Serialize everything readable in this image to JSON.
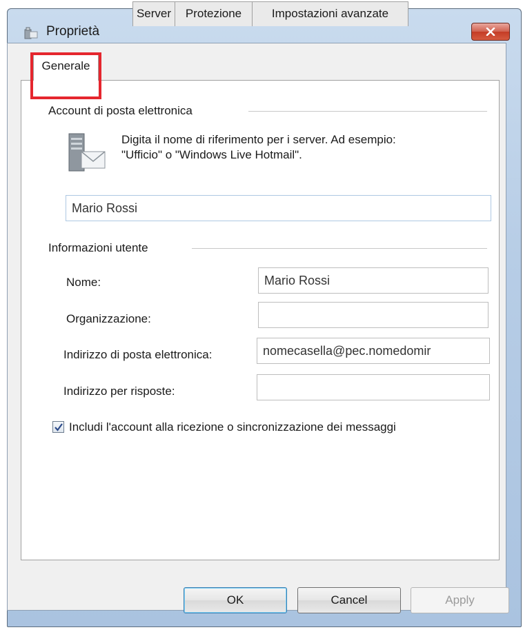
{
  "window": {
    "title": "Proprietà"
  },
  "tabs": [
    {
      "label": "Generale"
    },
    {
      "label": "Server"
    },
    {
      "label": "Protezione"
    },
    {
      "label": "Impostazioni avanzate"
    }
  ],
  "account": {
    "group_label": "Account di posta elettronica",
    "description_line1": "Digita il nome di riferimento per i server. Ad esempio:",
    "description_line2": "\"Ufficio\" o \"Windows Live Hotmail\".",
    "account_name": "Mario Rossi"
  },
  "user_info": {
    "group_label": "Informazioni utente",
    "name_label": "Nome:",
    "name_value": "Mario Rossi",
    "org_label": "Organizzazione:",
    "org_value": "",
    "email_label": "Indirizzo di posta elettronica:",
    "email_value": "nomecasella@pec.nomedomir",
    "reply_label": "Indirizzo per risposte:",
    "reply_value": ""
  },
  "include_checkbox": {
    "label": "Includi l'account alla ricezione o sincronizzazione dei messaggi",
    "checked": true
  },
  "buttons": {
    "ok": "OK",
    "cancel": "Cancel",
    "apply": "Apply"
  },
  "colors": {
    "highlight": "#e5262e",
    "close_button": "#c43c26"
  },
  "icons": [
    "window-icon",
    "close-icon",
    "server-mail-icon",
    "checkmark-icon"
  ]
}
